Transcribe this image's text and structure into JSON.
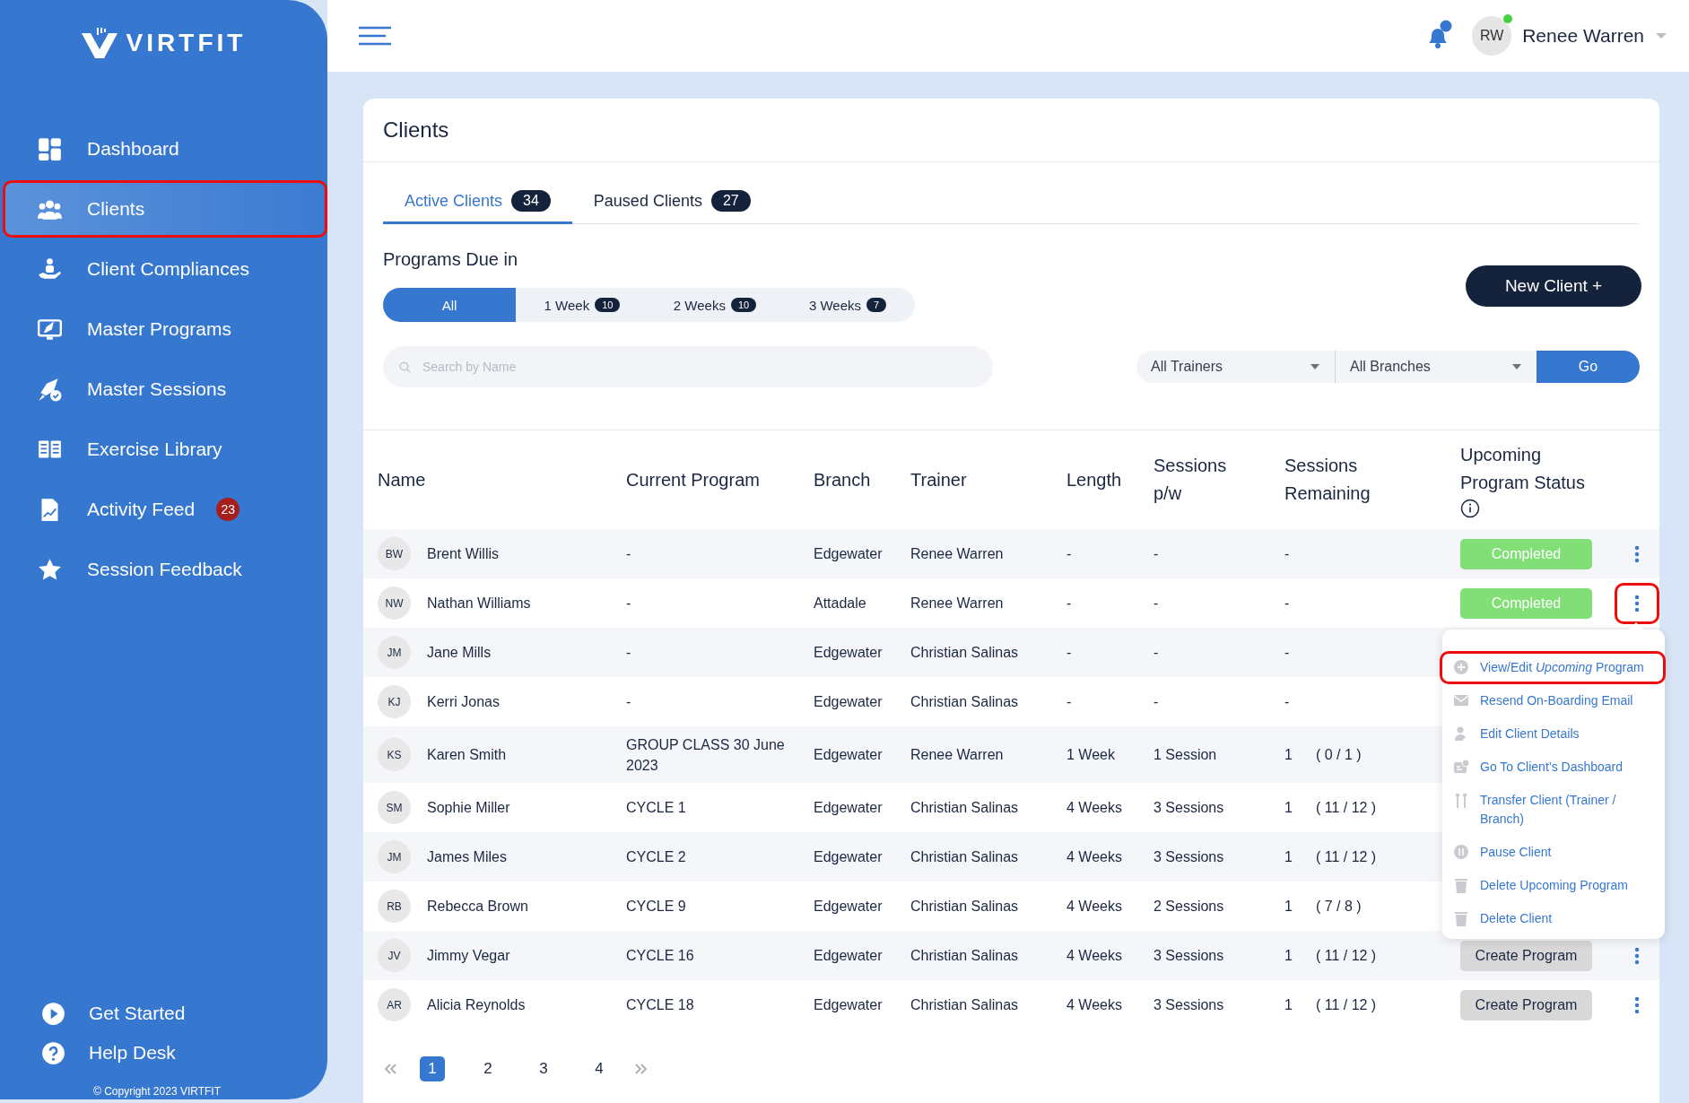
{
  "sidebar": {
    "logo": "VIRTFIT",
    "items": [
      {
        "label": "Dashboard",
        "selected": false,
        "highlighted": false
      },
      {
        "label": "Clients",
        "selected": true,
        "highlighted": true
      },
      {
        "label": "Client Compliances",
        "selected": false,
        "highlighted": false
      },
      {
        "label": "Master Programs",
        "selected": false,
        "highlighted": false
      },
      {
        "label": "Master Sessions",
        "selected": false,
        "highlighted": false
      },
      {
        "label": "Exercise Library",
        "selected": false,
        "highlighted": false
      },
      {
        "label": "Activity Feed",
        "selected": false,
        "highlighted": false,
        "badge": "23"
      },
      {
        "label": "Session Feedback",
        "selected": false,
        "highlighted": false
      }
    ],
    "footer_items": [
      {
        "label": "Get Started"
      },
      {
        "label": "Help Desk"
      }
    ],
    "copyright": "© Copyright 2023 VIRTFIT"
  },
  "header": {
    "user": {
      "initials": "RW",
      "name": "Renee Warren",
      "online": true
    },
    "notification": true
  },
  "page": {
    "title": "Clients",
    "tabs": [
      {
        "label": "Active Clients",
        "count": "34",
        "selected": true
      },
      {
        "label": "Paused Clients",
        "count": "27",
        "selected": false
      }
    ],
    "programs_due": {
      "label": "Programs Due in",
      "filters": [
        {
          "label": "All",
          "selected": true
        },
        {
          "label": "1 Week",
          "count": "10",
          "selected": false
        },
        {
          "label": "2 Weeks",
          "count": "10",
          "selected": false
        },
        {
          "label": "3 Weeks",
          "count": "7",
          "selected": false
        }
      ]
    },
    "new_client_button": "New Client +",
    "search": {
      "placeholder": "Search by Name"
    },
    "trainer_select": "All Trainers",
    "branch_select": "All Branches",
    "go_button": "Go",
    "table": {
      "columns": [
        "Name",
        "Current Program",
        "Branch",
        "Trainer",
        "Length",
        "Sessions p/w",
        "Sessions Remaining",
        "Upcoming Program Status"
      ],
      "rows": [
        {
          "initials": "BW",
          "name": "Brent Willis",
          "program": "-",
          "branch": "Edgewater",
          "trainer": "Renee Warren",
          "length": "-",
          "sessions_pw": "-",
          "remaining": "-",
          "status": {
            "kind": "completed",
            "label": "Completed"
          },
          "actions": true
        },
        {
          "initials": "NW",
          "name": "Nathan Williams",
          "program": "-",
          "branch": "Attadale",
          "trainer": "Renee Warren",
          "length": "-",
          "sessions_pw": "-",
          "remaining": "-",
          "status": {
            "kind": "completed",
            "label": "Completed"
          },
          "actions": true,
          "menu_open": true
        },
        {
          "initials": "JM",
          "name": "Jane Mills",
          "program": "-",
          "branch": "Edgewater",
          "trainer": "Christian Salinas",
          "length": "-",
          "sessions_pw": "-",
          "remaining": "-"
        },
        {
          "initials": "KJ",
          "name": "Kerri Jonas",
          "program": "-",
          "branch": "Edgewater",
          "trainer": "Christian Salinas",
          "length": "-",
          "sessions_pw": "-",
          "remaining": "-"
        },
        {
          "initials": "KS",
          "name": "Karen Smith",
          "program": "GROUP CLASS 30 June 2023",
          "branch": "Edgewater",
          "trainer": "Renee Warren",
          "length": "1 Week",
          "sessions_pw": "1 Session",
          "remaining": "1",
          "remaining_detail": "( 0 / 1 )"
        },
        {
          "initials": "SM",
          "name": "Sophie Miller",
          "program": "CYCLE 1",
          "branch": "Edgewater",
          "trainer": "Christian Salinas",
          "length": "4 Weeks",
          "sessions_pw": "3 Sessions",
          "remaining": "1",
          "remaining_detail": "( 11 / 12 )"
        },
        {
          "initials": "JM",
          "name": "James Miles",
          "program": "CYCLE 2",
          "branch": "Edgewater",
          "trainer": "Christian Salinas",
          "length": "4 Weeks",
          "sessions_pw": "3 Sessions",
          "remaining": "1",
          "remaining_detail": "( 11 / 12 )"
        },
        {
          "initials": "RB",
          "name": "Rebecca Brown",
          "program": "CYCLE 9",
          "branch": "Edgewater",
          "trainer": "Christian Salinas",
          "length": "4 Weeks",
          "sessions_pw": "2 Sessions",
          "remaining": "1",
          "remaining_detail": "( 7 / 8 )"
        },
        {
          "initials": "JV",
          "name": "Jimmy Vegar",
          "program": "CYCLE 16",
          "branch": "Edgewater",
          "trainer": "Christian Salinas",
          "length": "4 Weeks",
          "sessions_pw": "3 Sessions",
          "remaining": "1",
          "remaining_detail": "( 11 / 12 )",
          "status": {
            "kind": "create",
            "label": "Create Program"
          },
          "actions": true
        },
        {
          "initials": "AR",
          "name": "Alicia Reynolds",
          "program": "CYCLE 18",
          "branch": "Edgewater",
          "trainer": "Christian Salinas",
          "length": "4 Weeks",
          "sessions_pw": "3 Sessions",
          "remaining": "1",
          "remaining_detail": "( 11 / 12 )",
          "status": {
            "kind": "create",
            "label": "Create Program"
          },
          "actions": true
        }
      ]
    },
    "action_menu": {
      "highlight_trigger": true,
      "items": [
        {
          "label": "View/Edit *Upcoming* Program",
          "highlighted": true
        },
        {
          "label": "Resend On-Boarding Email",
          "highlighted": false
        },
        {
          "label": "Edit Client Details",
          "highlighted": false
        },
        {
          "label": "Go To Client’s Dashboard",
          "highlighted": false
        },
        {
          "label": "Transfer Client (Trainer / Branch)",
          "highlighted": false
        },
        {
          "label": "Pause Client",
          "highlighted": false
        },
        {
          "label": "Delete Upcoming Program",
          "highlighted": false
        },
        {
          "label": "Delete Client",
          "highlighted": false
        }
      ]
    },
    "pagination": {
      "pages": [
        {
          "label": "1",
          "selected": true
        },
        {
          "label": "2",
          "selected": false
        },
        {
          "label": "3",
          "selected": false
        },
        {
          "label": "4",
          "selected": false
        }
      ]
    }
  }
}
